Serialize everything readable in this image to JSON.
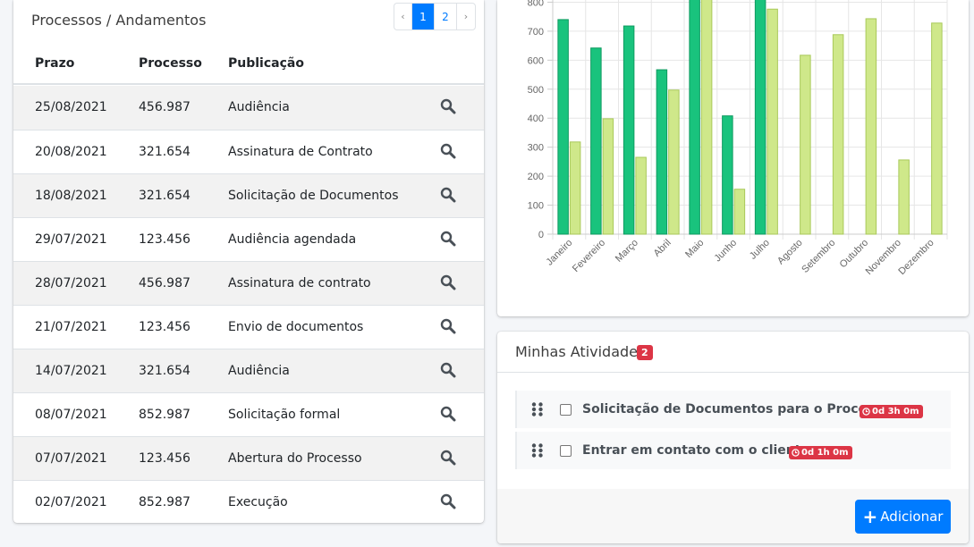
{
  "processos": {
    "title": "Processos / Andamentos",
    "pagination": {
      "prev": "‹",
      "pages": [
        "1",
        "2"
      ],
      "next": "›",
      "active": "1"
    },
    "columns": [
      "Prazo",
      "Processo",
      "Publicação"
    ],
    "rows": [
      {
        "prazo": "25/08/2021",
        "processo": "456.987",
        "publicacao": "Audiência"
      },
      {
        "prazo": "20/08/2021",
        "processo": "321.654",
        "publicacao": "Assinatura de Contrato"
      },
      {
        "prazo": "18/08/2021",
        "processo": "321.654",
        "publicacao": "Solicitação de Documentos"
      },
      {
        "prazo": "29/07/2021",
        "processo": "123.456",
        "publicacao": "Audiência agendada"
      },
      {
        "prazo": "28/07/2021",
        "processo": "456.987",
        "publicacao": "Assinatura de contrato"
      },
      {
        "prazo": "21/07/2021",
        "processo": "123.456",
        "publicacao": "Envio de documentos"
      },
      {
        "prazo": "14/07/2021",
        "processo": "321.654",
        "publicacao": "Audiência"
      },
      {
        "prazo": "08/07/2021",
        "processo": "852.987",
        "publicacao": "Solicitação formal"
      },
      {
        "prazo": "07/07/2021",
        "processo": "123.456",
        "publicacao": "Abertura do Processo"
      },
      {
        "prazo": "02/07/2021",
        "processo": "852.987",
        "publicacao": "Execução"
      }
    ],
    "row_action_icon": "search-icon"
  },
  "chart_data": {
    "type": "bar",
    "title": "",
    "xlabel": "",
    "ylabel": "",
    "categories": [
      "Janeiro",
      "Fevereiro",
      "Março",
      "Abril",
      "Maio",
      "Junho",
      "Julho",
      "Agosto",
      "Setembro",
      "Outubro",
      "Novembro",
      "Dezembro"
    ],
    "series": [
      {
        "color": "#19c37d",
        "values": [
          740,
          642,
          718,
          567,
          900,
          408,
          840,
          null,
          null,
          null,
          null,
          null
        ]
      },
      {
        "color": "#cfe88a",
        "values": [
          318,
          398,
          265,
          497,
          900,
          155,
          776,
          617,
          688,
          743,
          256,
          728
        ]
      }
    ],
    "yticks": [
      0,
      100,
      200,
      300,
      400,
      500,
      600,
      700,
      800
    ],
    "ylim": [
      0,
      900
    ],
    "grid": true,
    "legend": "none"
  },
  "atividades": {
    "title": "Minhas Atividades",
    "count": "2",
    "items": [
      {
        "text": "Solicitação de Documentos para o Processo",
        "time": "0d 3h 0m",
        "checked": false
      },
      {
        "text": "Entrar em contato com o cliente",
        "time": "0d 1h 0m",
        "checked": false
      }
    ],
    "add_label": "Adicionar",
    "accent": "#007bff",
    "badge_color": "#dc3545"
  }
}
